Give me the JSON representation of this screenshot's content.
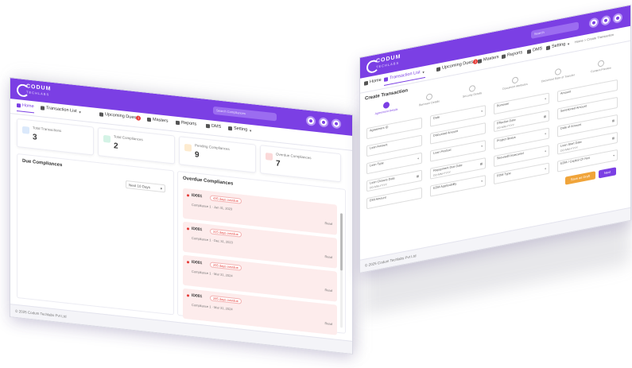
{
  "dashboard": {
    "logo": {
      "line1": "CODUM",
      "line2": "TECHLABS"
    },
    "search_placeholder": "Search Compliances",
    "nav": [
      {
        "label": "Home",
        "icon": "home-icon"
      },
      {
        "label": "Transaction List",
        "icon": "list-icon"
      },
      {
        "label": "Upcoming Dues",
        "icon": "calendar-icon",
        "badge": "1"
      },
      {
        "label": "Masters",
        "icon": "grid-icon"
      },
      {
        "label": "Reports",
        "icon": "report-icon"
      },
      {
        "label": "DMS",
        "icon": "folder-icon"
      },
      {
        "label": "Setting",
        "icon": "gear-icon"
      }
    ],
    "cards": [
      {
        "label": "Total Transactions",
        "value": "3",
        "color": "#4a90e2"
      },
      {
        "label": "Total Compliances",
        "value": "2",
        "color": "#34c38f"
      },
      {
        "label": "Pending Compliances",
        "value": "9",
        "color": "#f5a623"
      },
      {
        "label": "Overdue Compliances",
        "value": "7",
        "color": "#e53935"
      }
    ],
    "due_title": "Due Compliances",
    "due_filter": "Next 10 Days",
    "overdue_title": "Overdue Compliances",
    "overdue_items": [
      {
        "id": "ID001",
        "status": "435 days overdue",
        "sub": "Compliance 1 · Jan 31, 2023",
        "action": "Read"
      },
      {
        "id": "ID001",
        "status": "315 days overdue",
        "sub": "Compliance 1 · Dec 31, 2023",
        "action": "Read"
      },
      {
        "id": "ID001",
        "status": "255 days overdue",
        "sub": "Compliance 1 · Mar 31, 2024",
        "action": "Read"
      },
      {
        "id": "ID001",
        "status": "285 days overdue",
        "sub": "Compliance 1 · Mar 31, 2024",
        "action": "Read"
      }
    ],
    "footer": "© 2025 Codum Techlabs Pvt Ltd"
  },
  "form_window": {
    "search_placeholder": "Search",
    "breadcrumb": "Home > Create Transaction",
    "nav": [
      {
        "label": "Home",
        "icon": "home-icon"
      },
      {
        "label": "Transaction List",
        "icon": "list-icon"
      },
      {
        "label": "Upcoming Dues",
        "icon": "calendar-icon",
        "badge": "1"
      },
      {
        "label": "Masters",
        "icon": "grid-icon"
      },
      {
        "label": "Reports",
        "icon": "report-icon"
      },
      {
        "label": "DMS",
        "icon": "folder-icon"
      },
      {
        "label": "Setting",
        "icon": "gear-icon"
      }
    ],
    "title": "Create Transaction",
    "steps": [
      "Agreement Details",
      "Borrower Details",
      "Security Details",
      "Document Attributes",
      "Document Rate of Transfer",
      "Content Preview"
    ],
    "fields": [
      {
        "label": "Agreement ID",
        "value": ""
      },
      {
        "label": "Date",
        "value": ""
      },
      {
        "label": "Borrower",
        "value": ""
      },
      {
        "label": "Amount",
        "value": ""
      },
      {
        "label": "Loan Amount",
        "value": ""
      },
      {
        "label": "Disbursed Amount",
        "value": ""
      },
      {
        "label": "Effective Date",
        "value": "DD-MM-YYYY"
      },
      {
        "label": "Sanctioned Amount",
        "value": ""
      },
      {
        "label": "Loan Type",
        "value": ""
      },
      {
        "label": "Loan Product",
        "value": ""
      },
      {
        "label": "Project Status",
        "value": ""
      },
      {
        "label": "Date of Amount",
        "value": ""
      },
      {
        "label": "Loan Closure Date",
        "value": "DD-MM-YYYY"
      },
      {
        "label": "Repayment Due Date",
        "value": "DD-MM-YYYY"
      },
      {
        "label": "Secured/Unsecured",
        "value": ""
      },
      {
        "label": "Loan Start Date",
        "value": "DD-MM-YYYY"
      },
      {
        "label": "EMI Amount",
        "value": ""
      },
      {
        "label": "EDM Applicability",
        "value": ""
      },
      {
        "label": "EDM Type",
        "value": ""
      },
      {
        "label": "EDM / Capital Ch Nos",
        "value": ""
      }
    ],
    "save_draft": "Save as Draft",
    "next": "Next",
    "footer": "© 2025 Codum Techlabs Pvt Ltd",
    "colors": {
      "accent": "#7b3fe4",
      "draft": "#f0a43a"
    }
  }
}
